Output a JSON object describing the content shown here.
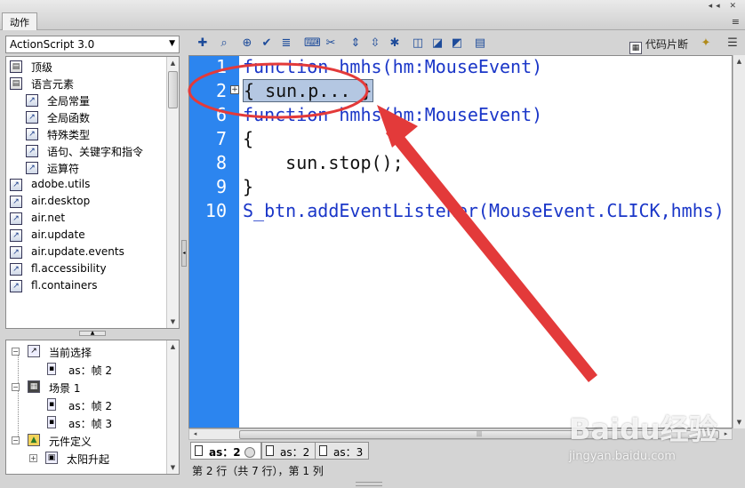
{
  "window": {
    "title": "动作"
  },
  "language_select": {
    "value": "ActionScript 3.0"
  },
  "toolbox_tree": [
    {
      "label": "顶级",
      "indent": 0,
      "icon": "book-icon"
    },
    {
      "label": "语言元素",
      "indent": 0,
      "icon": "book-icon"
    },
    {
      "label": "全局常量",
      "indent": 1,
      "icon": "arrow-icon"
    },
    {
      "label": "全局函数",
      "indent": 1,
      "icon": "arrow-icon"
    },
    {
      "label": "特殊类型",
      "indent": 1,
      "icon": "arrow-icon"
    },
    {
      "label": "语句、关键字和指令",
      "indent": 1,
      "icon": "arrow-icon"
    },
    {
      "label": "运算符",
      "indent": 1,
      "icon": "arrow-icon"
    },
    {
      "label": "adobe.utils",
      "indent": 0,
      "icon": "arrow-icon"
    },
    {
      "label": "air.desktop",
      "indent": 0,
      "icon": "arrow-icon"
    },
    {
      "label": "air.net",
      "indent": 0,
      "icon": "arrow-icon"
    },
    {
      "label": "air.update",
      "indent": 0,
      "icon": "arrow-icon"
    },
    {
      "label": "air.update.events",
      "indent": 0,
      "icon": "arrow-icon"
    },
    {
      "label": "fl.accessibility",
      "indent": 0,
      "icon": "arrow-icon"
    },
    {
      "label": "fl.containers",
      "indent": 0,
      "icon": "arrow-icon"
    }
  ],
  "script_nav": {
    "current_selection": "当前选择",
    "current_item": "as：帧 2",
    "scene": "场景 1",
    "scene_items": [
      "as：帧 2",
      "as：帧 3"
    ],
    "symbol_defs": "元件定义",
    "symbol_item": "太阳升起"
  },
  "toolbar": {
    "snippet_label": "代码片断"
  },
  "code_lines": [
    {
      "num": "1",
      "text": "function hmhs(hm:MouseEvent)"
    },
    {
      "num": "2",
      "text": "{ sun.p... }"
    },
    {
      "num": "6",
      "text": "function hmhs(hm:MouseEvent)"
    },
    {
      "num": "7",
      "text": "{"
    },
    {
      "num": "8",
      "text": "    sun.stop();"
    },
    {
      "num": "9",
      "text": "}"
    },
    {
      "num": "10",
      "text": "S_btn.addEventListener(MouseEvent.CLICK,hmhs)"
    }
  ],
  "tabs": [
    {
      "label": "as：2",
      "active": true
    },
    {
      "label": "as：2",
      "active": false
    },
    {
      "label": "as：3",
      "active": false
    }
  ],
  "status": "第 2 行（共 7 行），第 1 列",
  "watermark": {
    "brand": "Baidu经验",
    "url": "jingyan.baidu.com"
  },
  "colors": {
    "gutter": "#2c85ef",
    "annotation": "#e33a3a",
    "keyword": "#1a36c8"
  }
}
